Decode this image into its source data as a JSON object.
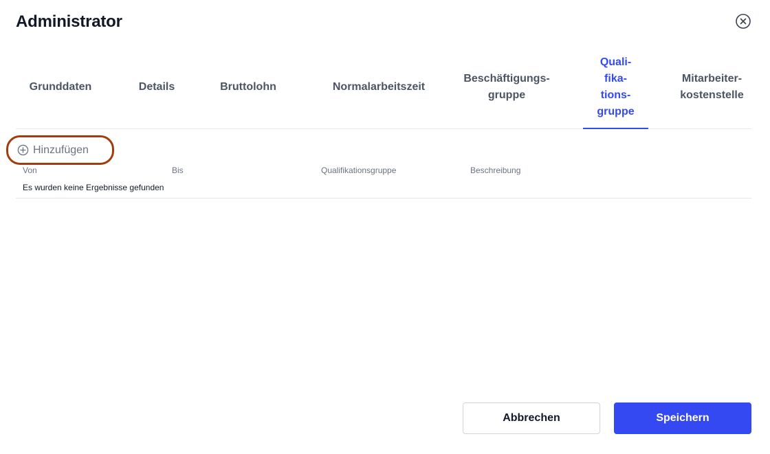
{
  "dialog": {
    "title": "Administrator",
    "close_icon": "close-circle-icon"
  },
  "tabs": [
    {
      "label": "Grunddaten",
      "active": false
    },
    {
      "label": "Details",
      "active": false
    },
    {
      "label": "Bruttolohn",
      "active": false
    },
    {
      "label": "Normalarbeitszeit",
      "active": false
    },
    {
      "label": "Beschäftigungs-\ngruppe",
      "active": false
    },
    {
      "label": "Quali-\nfika-\ntions-\ngruppe",
      "active": true
    },
    {
      "label": "Mitarbeiter-\nkostenstelle",
      "active": false
    }
  ],
  "add": {
    "label": "Hinzufügen",
    "icon": "plus-circle-icon"
  },
  "table": {
    "columns": [
      "Von",
      "Bis",
      "Qualifikationsgruppe",
      "Beschreibung"
    ],
    "empty_text": "Es wurden keine Ergebnisse gefunden"
  },
  "footer": {
    "cancel_label": "Abbrechen",
    "save_label": "Speichern"
  },
  "colors": {
    "accent": "#3449f1",
    "highlight_ring": "#a23c0e"
  }
}
